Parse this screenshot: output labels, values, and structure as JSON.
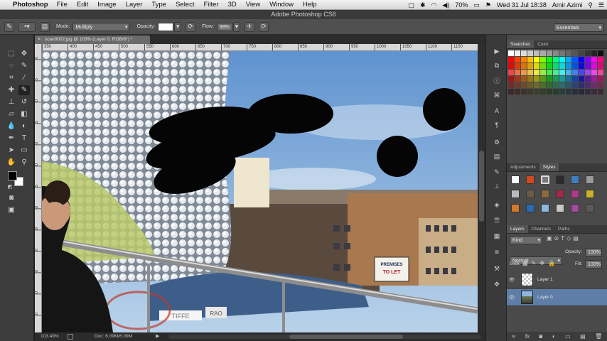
{
  "menubar": {
    "app": "Photoshop",
    "items": [
      "File",
      "Edit",
      "Image",
      "Layer",
      "Type",
      "Select",
      "Filter",
      "3D",
      "View",
      "Window",
      "Help"
    ],
    "battery": "70%",
    "datetime": "Wed 31 Jul  18:38",
    "user": "Amir Azimi"
  },
  "title": "Adobe Photoshop CS6",
  "options": {
    "mode_label": "Mode:",
    "mode_value": "Multiply",
    "opacity_label": "Opacity:",
    "opacity_value": "",
    "flow_label": "Flow:",
    "flow_value": "98%",
    "workspace": "Essentials"
  },
  "document": {
    "tab": "scan0002.jpg @ 103% (Layer 0, RGB/8*) *",
    "ruler_h": [
      "350",
      "400",
      "450",
      "500",
      "550",
      "600",
      "650",
      "700",
      "750",
      "800",
      "850",
      "900",
      "950",
      "1000",
      "1050",
      "1100",
      "1150"
    ],
    "ruler_v": [
      "0",
      "5",
      "0",
      "5",
      "0",
      "0",
      "5",
      "0",
      "9",
      "0",
      "0",
      "0",
      "0"
    ],
    "zoom": "103.49%",
    "doc_info": "Doc: 6.09M/6.09M"
  },
  "photo": {
    "sign1": "PREMISES",
    "sign2": "TO LET",
    "sign3": "TIFFE",
    "sign4": "RAO"
  },
  "panels": {
    "swatches_tabs": [
      "Swatches",
      "Color"
    ],
    "adj_tabs": [
      "Adjustments",
      "Styles"
    ],
    "layers_tabs": [
      "Layers",
      "Channels",
      "Paths"
    ],
    "kind": "Kind",
    "blend": "Normal",
    "opacity_label": "Opacity:",
    "opacity": "100%",
    "lock_label": "Lock:",
    "fill_label": "Fill:",
    "fill": "100%",
    "layers": [
      {
        "name": "Layer 1",
        "selected": false
      },
      {
        "name": "Layer 0",
        "selected": true
      }
    ]
  },
  "colors": {
    "accent": "#5e7ea8",
    "panel": "#4a4a4a",
    "sky": "#7aa6d6"
  }
}
